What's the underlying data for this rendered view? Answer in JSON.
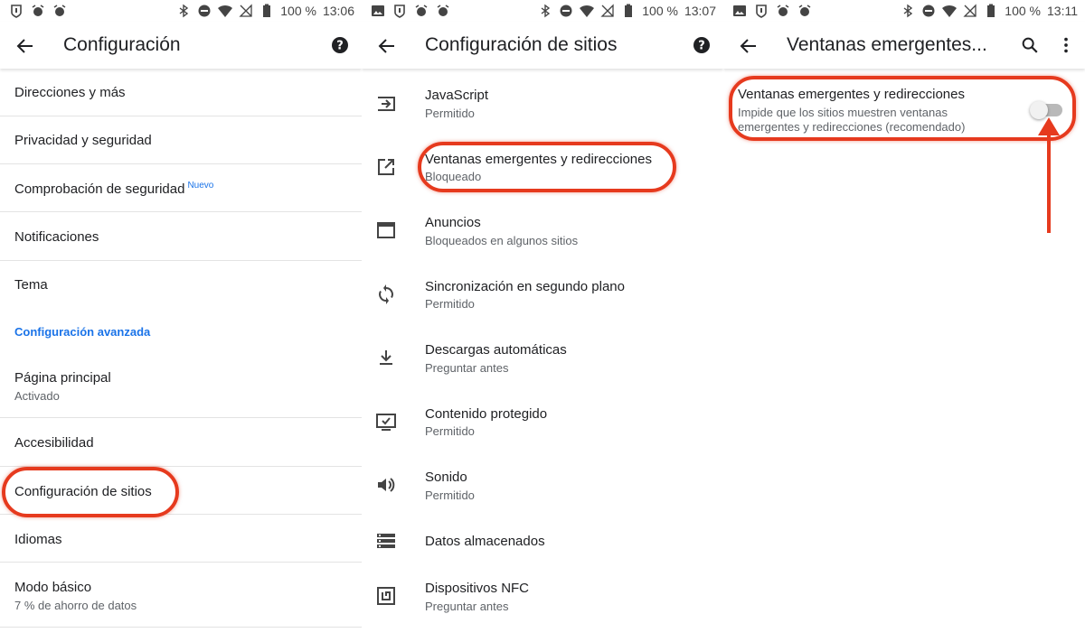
{
  "colors": {
    "accent": "#1a73e8",
    "highlight": "#e63a1e",
    "text": "#202124",
    "subtext": "#5f6368"
  },
  "statusbar": [
    {
      "time": "13:06",
      "battery": "100 %"
    },
    {
      "time": "13:07",
      "battery": "100 %"
    },
    {
      "time": "13:11",
      "battery": "100 %"
    }
  ],
  "panel1": {
    "title": "Configuración",
    "items": [
      {
        "title": "Direcciones y más"
      },
      {
        "title": "Privacidad y seguridad"
      },
      {
        "title": "Comprobación de seguridad",
        "badge": "Nuevo"
      },
      {
        "title": "Notificaciones"
      },
      {
        "title": "Tema"
      },
      {
        "title": "Página principal",
        "subtitle": "Activado"
      },
      {
        "title": "Accesibilidad"
      },
      {
        "title": "Configuración de sitios"
      },
      {
        "title": "Idiomas"
      },
      {
        "title": "Modo básico",
        "subtitle": "7 % de ahorro de datos"
      }
    ],
    "section": "Configuración avanzada"
  },
  "panel2": {
    "title": "Configuración de sitios",
    "items": [
      {
        "title": "JavaScript",
        "subtitle": "Permitido",
        "icon": "javascript-icon"
      },
      {
        "title": "Ventanas emergentes y redirecciones",
        "subtitle": "Bloqueado",
        "icon": "open-in-new-icon"
      },
      {
        "title": "Anuncios",
        "subtitle": "Bloqueados en algunos sitios",
        "icon": "window-icon"
      },
      {
        "title": "Sincronización en segundo plano",
        "subtitle": "Permitido",
        "icon": "sync-icon"
      },
      {
        "title": "Descargas automáticas",
        "subtitle": "Preguntar antes",
        "icon": "download-icon"
      },
      {
        "title": "Contenido protegido",
        "subtitle": "Permitido",
        "icon": "protected-content-icon"
      },
      {
        "title": "Sonido",
        "subtitle": "Permitido",
        "icon": "volume-icon"
      },
      {
        "title": "Datos almacenados",
        "subtitle": "",
        "icon": "storage-icon"
      },
      {
        "title": "Dispositivos NFC",
        "subtitle": "Preguntar antes",
        "icon": "nfc-icon"
      }
    ]
  },
  "panel3": {
    "title": "Ventanas emergentes...",
    "setting_title": "Ventanas emergentes y redirecciones",
    "setting_desc_line1": "Impide que los sitios muestren ventanas",
    "setting_desc_line2": "emergentes y redirecciones (recomendado)",
    "toggle_on": false
  }
}
